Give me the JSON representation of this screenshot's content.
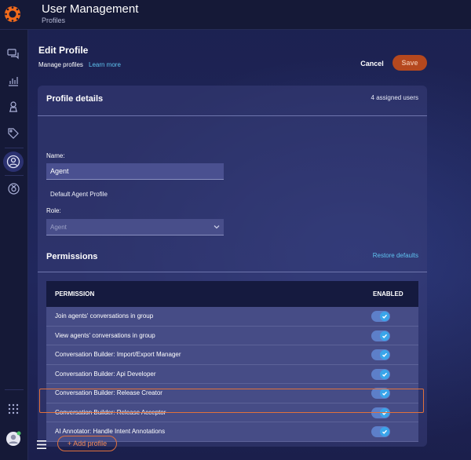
{
  "header": {
    "title": "User Management",
    "subtitle": "Profiles"
  },
  "sidebar": {
    "items": [
      {
        "icon": "conversations-icon"
      },
      {
        "icon": "analytics-icon"
      },
      {
        "icon": "bot-icon"
      },
      {
        "icon": "tag-icon"
      },
      {
        "icon": "users-icon",
        "active": true
      },
      {
        "icon": "automation-icon"
      },
      {
        "icon": "apps-grid-icon"
      },
      {
        "icon": "avatar"
      }
    ]
  },
  "page": {
    "title": "Edit Profile",
    "manage_text": "Manage profiles",
    "learn_more": "Learn more",
    "cancel_label": "Cancel",
    "save_label": "Save"
  },
  "profile": {
    "section_title": "Profile details",
    "assigned_users": "4 assigned users",
    "name_label": "Name:",
    "name_value": "Agent",
    "description": "Default Agent Profile",
    "role_label": "Role:",
    "role_value": "Agent"
  },
  "permissions": {
    "title": "Permissions",
    "restore_label": "Restore defaults",
    "col_permission": "PERMISSION",
    "col_enabled": "ENABLED",
    "rows": [
      {
        "label": "Join agents' conversations in group",
        "enabled": true
      },
      {
        "label": "View agents' conversations in group",
        "enabled": true
      },
      {
        "label": "Conversation Builder: Import/Export Manager",
        "enabled": true
      },
      {
        "label": "Conversation Builder: Api Developer",
        "enabled": true
      },
      {
        "label": "Conversation Builder: Release Creator",
        "enabled": true
      },
      {
        "label": "Conversation Builder: Release Acceptor",
        "enabled": true
      },
      {
        "label": "AI Annotator: Handle Intent Annotations",
        "enabled": true
      }
    ]
  },
  "footer": {
    "add_profile_label": "+ Add profile"
  },
  "colors": {
    "accent": "#e0713c",
    "link": "#5fc3f0",
    "toggle_on": "#3aa5ea"
  }
}
